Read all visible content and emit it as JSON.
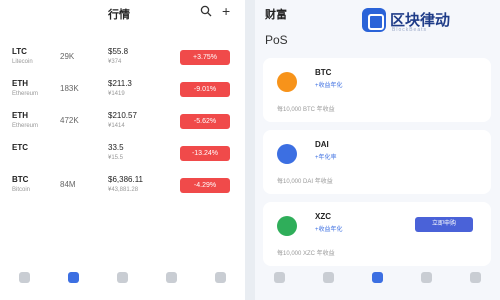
{
  "left": {
    "title": "行情",
    "rows": [
      {
        "symbol": "LTC",
        "pair": "Litecoin",
        "volume": "29K",
        "price": "$55.8",
        "cny": "¥374",
        "change": "+3.75%"
      },
      {
        "symbol": "ETH",
        "pair": "Ethereum",
        "volume": "183K",
        "price": "$211.3",
        "cny": "¥1419",
        "change": "-9.01%"
      },
      {
        "symbol": "ETH",
        "pair": "Ethereum",
        "volume": "472K",
        "price": "$210.57",
        "cny": "¥1414",
        "change": "-5.62%"
      },
      {
        "symbol": "ETC",
        "pair": "",
        "volume": "",
        "price": "33.5",
        "cny": "¥15.5",
        "change": "-13.24%"
      },
      {
        "symbol": "BTC",
        "pair": "Bitcoin",
        "volume": "84M",
        "price": "$6,386.11",
        "cny": "¥43,881.28",
        "change": "-4.29%"
      }
    ],
    "nav": [
      "",
      "",
      "",
      "",
      ""
    ]
  },
  "right": {
    "title": "财富",
    "section": "PoS",
    "cards": [
      {
        "name": "BTC",
        "sub": "+收益年化",
        "button": "",
        "foot": "每10,000 BTC 年收益",
        "coin_color": "#f7931a"
      },
      {
        "name": "DAI",
        "sub": "+年化率",
        "button": "",
        "foot": "每10,000 DAI 年收益",
        "coin_color": "#3c6fe2"
      },
      {
        "name": "XZC",
        "sub": "+收益年化",
        "button": "立即申购",
        "foot": "每10,000 XZC 年收益",
        "coin_color": "#2fae5a"
      }
    ],
    "nav": [
      "",
      "",
      "",
      "",
      ""
    ]
  },
  "logo": {
    "text": "区块律动",
    "sub": "BlockBeats"
  },
  "colors": {
    "accent": "#3c6fe2",
    "down": "#f04a4a",
    "button": "#4a62d8"
  }
}
